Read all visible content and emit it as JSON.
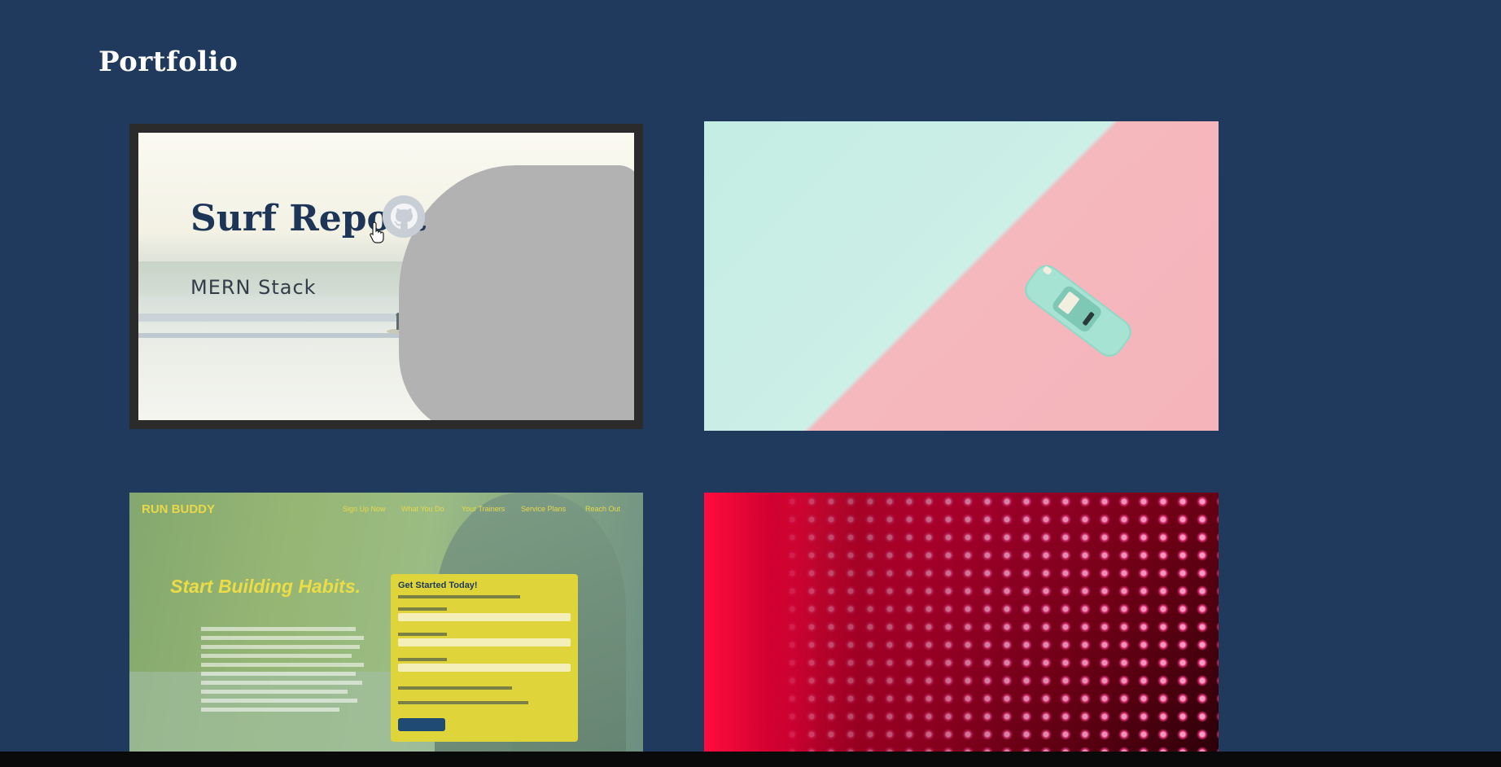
{
  "section": {
    "title": "Portfolio"
  },
  "projects": [
    {
      "title": "Surf Report",
      "subtitle": "MERN Stack",
      "icon": "github-icon",
      "state": "hover"
    },
    {
      "title": "",
      "image": "toy-car-on-mint-and-pink"
    },
    {
      "image": "run-buddy-screenshot",
      "brand": "RUN BUDDY",
      "nav": [
        "Sign Up Now",
        "What You Do",
        "Your Trainers",
        "Service Plans",
        "Reach Out"
      ],
      "hero": "Start Building Habits.",
      "form_title": "Get Started Today!"
    },
    {
      "title": "",
      "image": "red-led-matrix"
    }
  ],
  "colors": {
    "background": "#1f3a5c",
    "title": "#ffffff",
    "accent": "#1d3557"
  }
}
